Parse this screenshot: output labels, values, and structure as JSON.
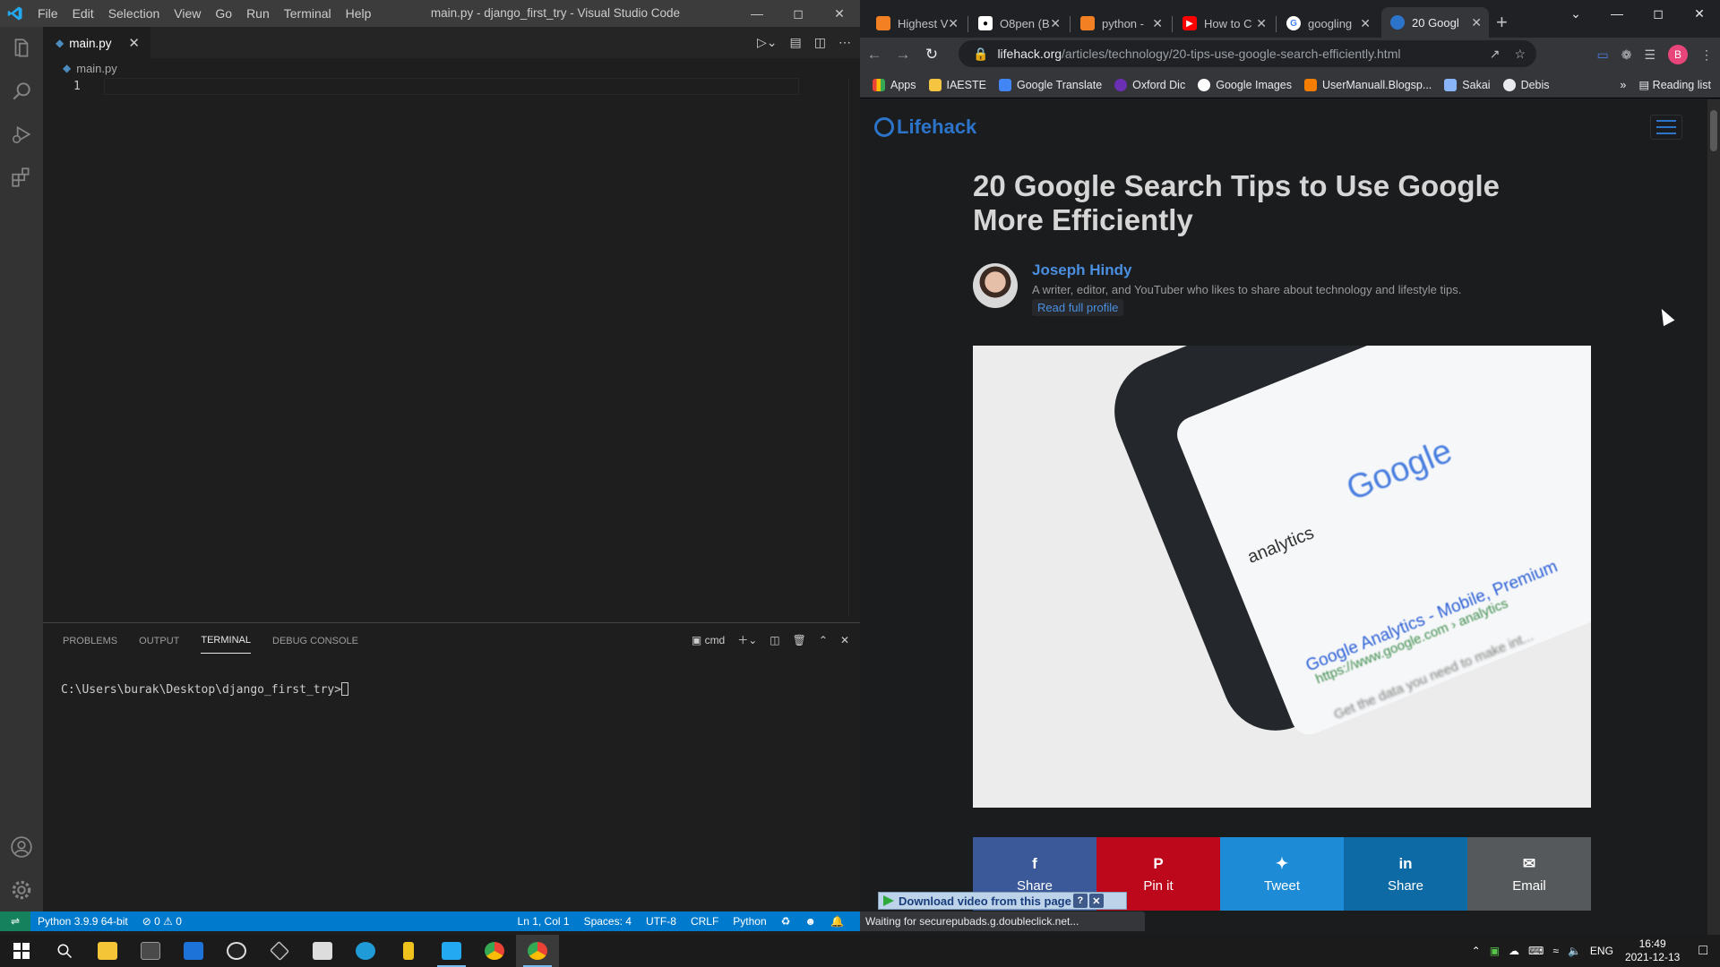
{
  "vscode": {
    "menu": [
      "File",
      "Edit",
      "Selection",
      "View",
      "Go",
      "Run",
      "Terminal",
      "Help"
    ],
    "window_title": "main.py - django_first_try - Visual Studio Code",
    "active_tab": "main.py",
    "breadcrumb": "main.py",
    "line_number": "1",
    "panel_tabs": [
      "PROBLEMS",
      "OUTPUT",
      "TERMINAL",
      "DEBUG CONSOLE"
    ],
    "terminal_shell": "cmd",
    "terminal_prompt": "C:\\Users\\burak\\Desktop\\django_first_try>",
    "status": {
      "interpreter": "Python 3.9.9 64-bit",
      "errors": "0",
      "warnings": "0",
      "position": "Ln 1, Col 1",
      "spaces": "Spaces: 4",
      "encoding": "UTF-8",
      "eol": "CRLF",
      "language": "Python"
    }
  },
  "chrome": {
    "tabs": [
      {
        "title": "Highest V",
        "icon": "stackoverflow-icon",
        "color": "#f48024"
      },
      {
        "title": "O8pen (B",
        "icon": "github-icon",
        "color": "#ffffff"
      },
      {
        "title": "python -",
        "icon": "stackoverflow-icon",
        "color": "#f48024"
      },
      {
        "title": "How to C",
        "icon": "youtube-icon",
        "color": "#ff0000"
      },
      {
        "title": "googling",
        "icon": "google-icon",
        "color": "#4285f4"
      },
      {
        "title": "20 Googl",
        "icon": "lifehack-icon",
        "color": "#2c74c9"
      }
    ],
    "url_host": "lifehack.org",
    "url_path": "/articles/technology/20-tips-use-google-search-efficiently.html",
    "profile_initial": "B",
    "bookmarks": [
      "Apps",
      "IAESTE",
      "Google Translate",
      "Oxford Dic",
      "Google Images",
      "UserManuall.Blogsp...",
      "Sakai",
      "Debis"
    ],
    "reading_list": "Reading list",
    "status_text": "Waiting for securepubads.g.doubleclick.net..."
  },
  "article": {
    "site_name": "Lifehack",
    "title": "20 Google Search Tips to Use Google More Efficiently",
    "author": "Joseph Hindy",
    "author_desc": "A writer, editor, and YouTuber who likes to share about technology and lifestyle tips.",
    "profile_link": "Read full profile",
    "hero_text": {
      "logo": "Google",
      "query": "analytics",
      "result": "Google Analytics - Mobile, Premium",
      "url": "https://www.google.com › analytics",
      "snippet": "Get the data you need to make int..."
    },
    "share_buttons": [
      {
        "label": "Share",
        "icon": "facebook-icon",
        "color": "#3b5998"
      },
      {
        "label": "Pin it",
        "icon": "pinterest-icon",
        "color": "#bd081c"
      },
      {
        "label": "Tweet",
        "icon": "twitter-icon",
        "color": "#1d8bd6"
      },
      {
        "label": "Share",
        "icon": "linkedin-icon",
        "color": "#0e6aa4"
      },
      {
        "label": "Email",
        "icon": "email-icon",
        "color": "#55595c"
      }
    ],
    "download_bar": "Download video from this page"
  },
  "taskbar": {
    "language": "ENG",
    "time": "16:49",
    "date": "2021-12-13"
  }
}
